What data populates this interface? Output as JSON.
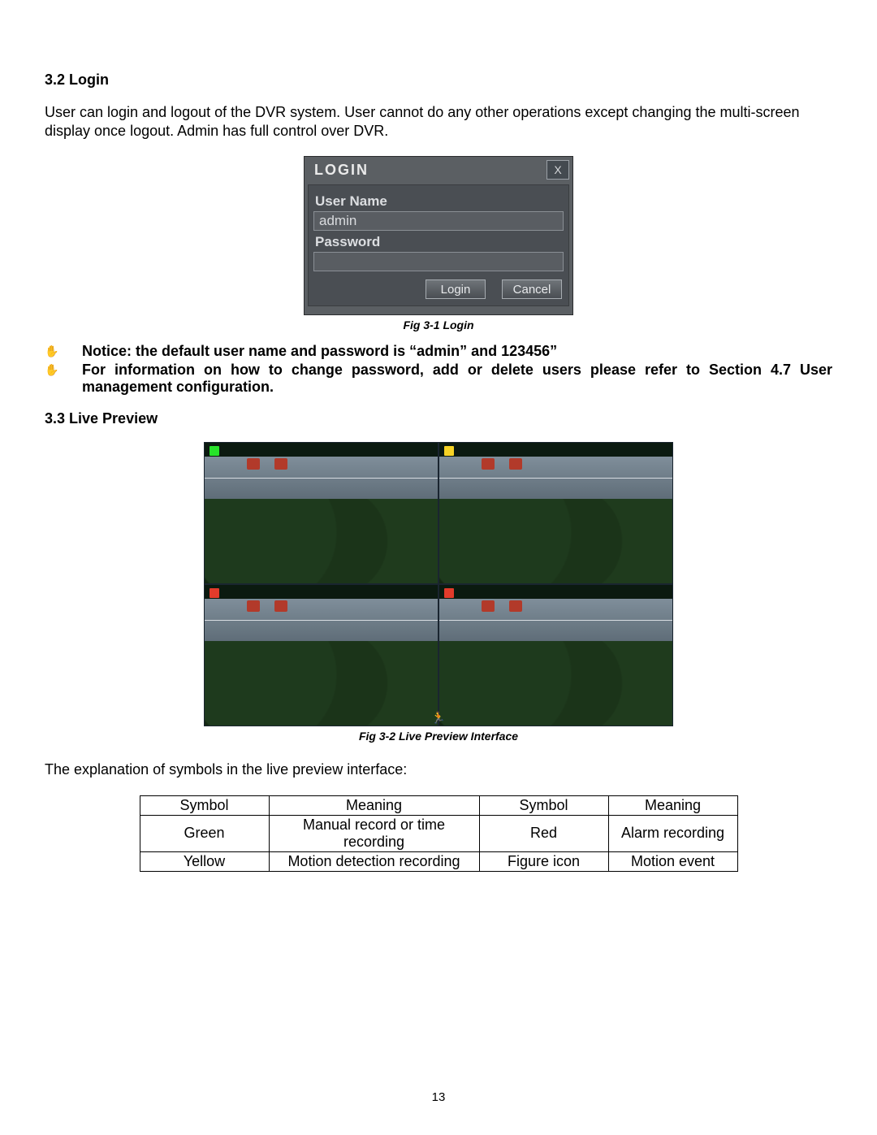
{
  "page_number": "13",
  "section_3_2_title": "3.2 Login",
  "section_3_2_body": "User can login and logout of the DVR system. User cannot do any other operations except changing the multi-screen display once logout. Admin has full control over DVR.",
  "login_dialog": {
    "title": "LOGIN",
    "close_label": "X",
    "username_label": "User Name",
    "username_value": "admin",
    "password_label": "Password",
    "password_value": "",
    "login_button": "Login",
    "cancel_button": "Cancel"
  },
  "fig_3_1_caption": "Fig 3-1 Login",
  "notices": {
    "icon": "✋",
    "line1": "Notice: the default user name and password is “admin” and 123456”",
    "line2": "For information on how to change password, add or delete users please refer to Section 4.7 User management configuration."
  },
  "section_3_3_title": "3.3 Live Preview",
  "fig_3_2_caption": "Fig 3-2 Live Preview Interface",
  "section_3_3_body": "The explanation of symbols in the live preview interface:",
  "symbol_table": {
    "headers": {
      "c1": "Symbol",
      "c2": "Meaning",
      "c3": "Symbol",
      "c4": "Meaning"
    },
    "rows": [
      {
        "c1": "Green",
        "c2": "Manual record or time recording",
        "c3": "Red",
        "c4": "Alarm recording"
      },
      {
        "c1": "Yellow",
        "c2": "Motion detection recording",
        "c3": "Figure icon",
        "c4": "Motion event"
      }
    ]
  },
  "preview_indicators": {
    "tl": "green",
    "tr": "yellow",
    "bl": "red",
    "br": "red"
  }
}
